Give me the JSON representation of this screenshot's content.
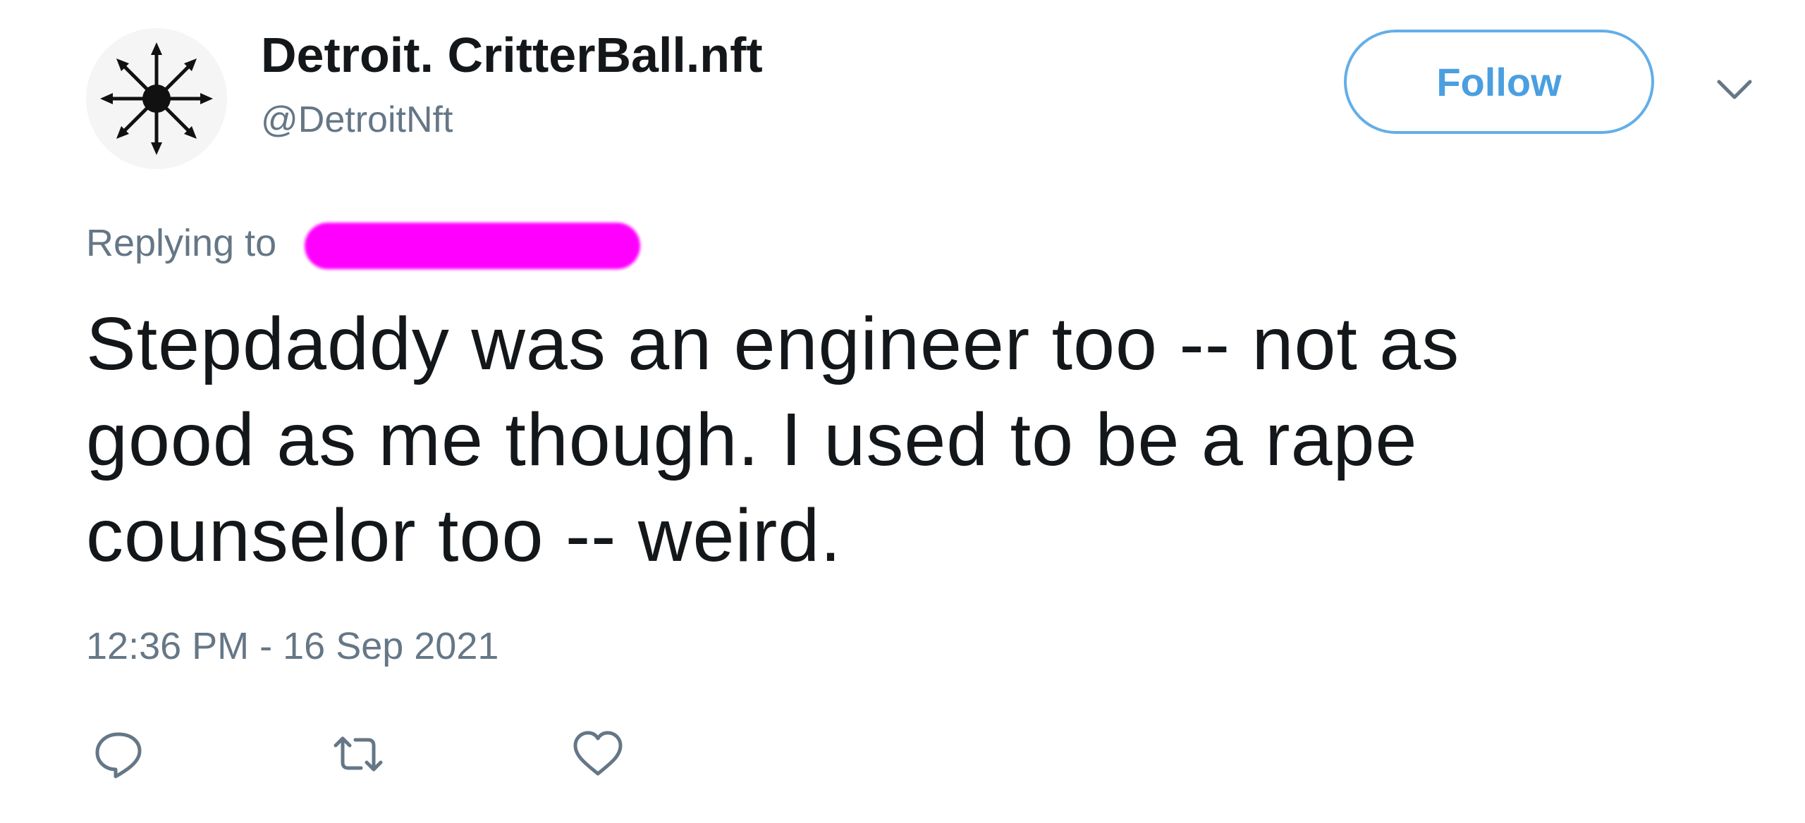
{
  "tweet": {
    "display_name": "Detroit. CritterBall.nft",
    "handle": "@DetroitNft",
    "follow_label": "Follow",
    "replying_prefix": "Replying to",
    "text": "Stepdaddy was an engineer too -- not as good as me though. I used to be a rape counselor too -- weird.",
    "timestamp": "12:36 PM - 16 Sep 2021"
  },
  "icons": {
    "avatar": "chaos-star-icon",
    "menu": "chevron-down-icon",
    "reply": "reply-icon",
    "retweet": "retweet-icon",
    "like": "heart-icon"
  },
  "colors": {
    "follow_border": "#63aee8",
    "follow_text": "#4a9fe0",
    "secondary_text": "#657786",
    "primary_text": "#14171a",
    "redaction": "#ff00ff",
    "icon": "#657786"
  }
}
